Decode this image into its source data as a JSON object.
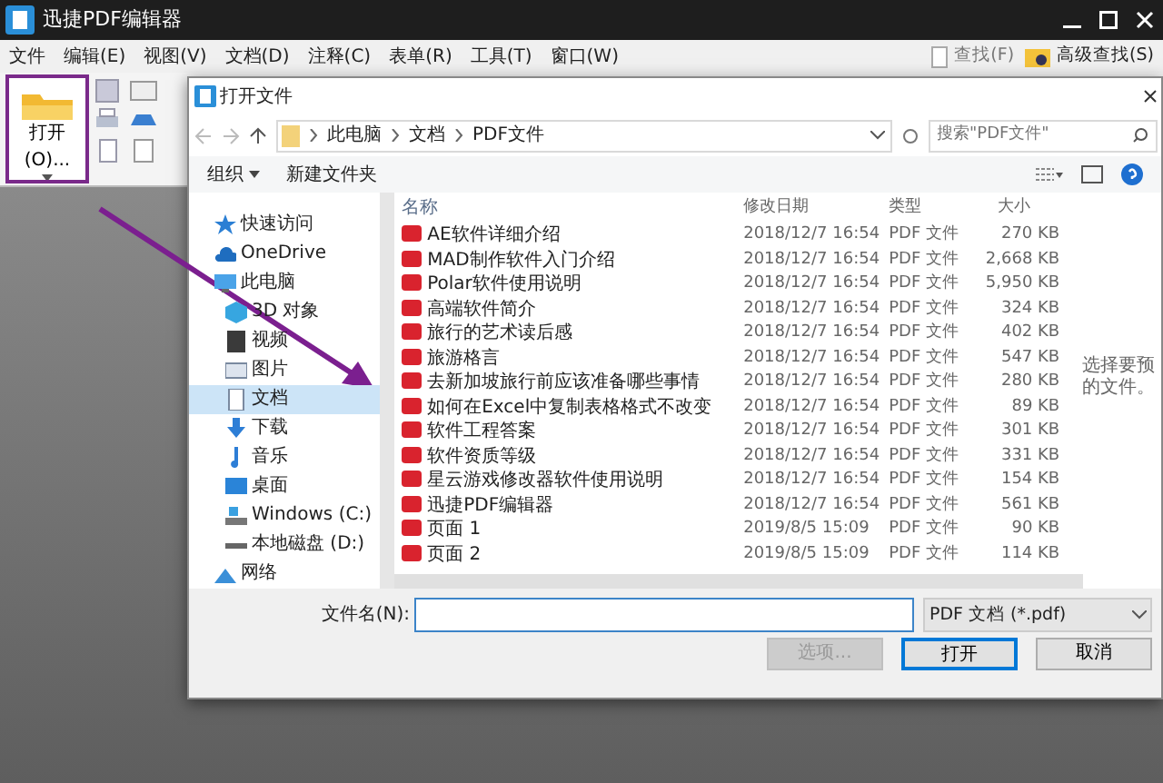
{
  "window": {
    "title": "迅捷PDF编辑器"
  },
  "menu": [
    "文件",
    "编辑(E)",
    "视图(V)",
    "文档(D)",
    "注释(C)",
    "表单(R)",
    "工具(T)",
    "窗口(W)"
  ],
  "toolbar": {
    "open_button": {
      "label": "打开(O)...",
      "highlighted": true
    },
    "find": "查找(F)",
    "advanced_find": "高级查找(S)"
  },
  "dialog": {
    "title": "打开文件",
    "breadcrumb": [
      "此电脑",
      "文档",
      "PDF文件"
    ],
    "search": {
      "placeholder": "搜索\"PDF文件\""
    },
    "commands": [
      {
        "kind": "menu",
        "label": "组织"
      },
      {
        "kind": "plain",
        "label": "新建文件夹"
      }
    ],
    "sidebar": [
      {
        "kind": "star",
        "label": "快速访问",
        "selected": false
      },
      {
        "kind": "cloud",
        "label": "OneDrive",
        "selected": false
      },
      {
        "kind": "pc",
        "label": "此电脑",
        "selected": false,
        "children": [
          {
            "kind": "cube",
            "label": "3D 对象",
            "selected": false
          },
          {
            "kind": "film",
            "label": "视频",
            "selected": false
          },
          {
            "kind": "picture",
            "label": "图片",
            "selected": false
          },
          {
            "kind": "doc",
            "label": "文档",
            "selected": true
          },
          {
            "kind": "download",
            "label": "下载",
            "selected": false
          },
          {
            "kind": "music",
            "label": "音乐",
            "selected": false
          },
          {
            "kind": "desktop",
            "label": "桌面",
            "selected": false
          },
          {
            "kind": "drive",
            "label": "Windows (C:)",
            "selected": false
          },
          {
            "kind": "disk",
            "label": "本地磁盘 (D:)",
            "selected": false
          }
        ]
      },
      {
        "kind": "network",
        "label": "网络",
        "selected": false
      }
    ],
    "table": {
      "columns": [
        "名称",
        "修改日期",
        "类型",
        "大小"
      ],
      "rows": [
        [
          "AE软件详细介绍",
          "2018/12/7 16:54",
          "PDF 文件",
          "270 KB"
        ],
        [
          "MAD制作软件入门介绍",
          "2018/12/7 16:54",
          "PDF 文件",
          "2,668 KB"
        ],
        [
          "Polar软件使用说明",
          "2018/12/7 16:54",
          "PDF 文件",
          "5,950 KB"
        ],
        [
          "高端软件简介",
          "2018/12/7 16:54",
          "PDF 文件",
          "324 KB"
        ],
        [
          "旅行的艺术读后感",
          "2018/12/7 16:54",
          "PDF 文件",
          "402 KB"
        ],
        [
          "旅游格言",
          "2018/12/7 16:54",
          "PDF 文件",
          "547 KB"
        ],
        [
          "去新加坡旅行前应该准备哪些事情",
          "2018/12/7 16:54",
          "PDF 文件",
          "280 KB"
        ],
        [
          "如何在Excel中复制表格格式不改变",
          "2018/12/7 16:54",
          "PDF 文件",
          "89 KB"
        ],
        [
          "软件工程答案",
          "2018/12/7 16:54",
          "PDF 文件",
          "301 KB"
        ],
        [
          "软件资质等级",
          "2018/12/7 16:54",
          "PDF 文件",
          "331 KB"
        ],
        [
          "星云游戏修改器软件使用说明",
          "2018/12/7 16:54",
          "PDF 文件",
          "154 KB"
        ],
        [
          "迅捷PDF编辑器",
          "2018/12/7 16:54",
          "PDF 文件",
          "561 KB"
        ],
        [
          "页面 1",
          "2019/8/5 15:09",
          "PDF 文件",
          "90 KB"
        ],
        [
          "页面 2",
          "2019/8/5 15:09",
          "PDF 文件",
          "114 KB"
        ]
      ]
    },
    "preview_text": [
      "选择要预",
      "的文件。"
    ],
    "filename_label": "文件名(N):",
    "filetype": "PDF 文档 (*.pdf)",
    "buttons": [
      {
        "label": "选项...",
        "disabled": true,
        "default": false
      },
      {
        "label": "打开",
        "disabled": false,
        "default": true
      },
      {
        "label": "取消",
        "disabled": false,
        "default": false
      }
    ]
  }
}
